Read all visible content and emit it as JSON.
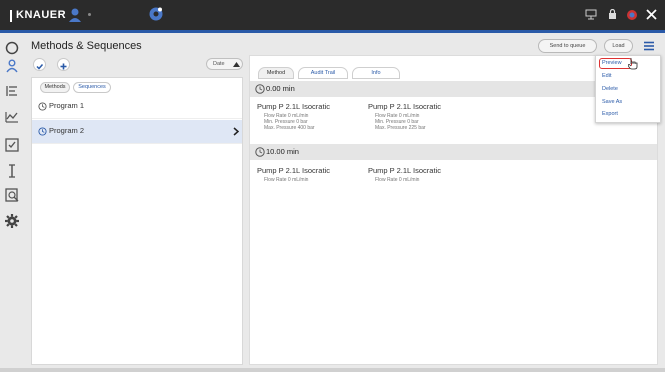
{
  "brand": {
    "name": "KNAUER"
  },
  "header": {
    "title": "Methods & Sequences",
    "send_to_queue": "Send to queue",
    "load": "Load"
  },
  "left": {
    "sort_label": "Date",
    "tabs": [
      "Methods",
      "Sequences"
    ],
    "programs": [
      "Program 1",
      "Program 2"
    ]
  },
  "right": {
    "tabs": [
      "Method",
      "Audit Trail",
      "Info"
    ],
    "blocks": [
      {
        "time": "0.00 min",
        "pumps": [
          {
            "title": "Pump P 2.1L Isocratic",
            "params": [
              "Flow Rate 0 mL/min",
              "Min. Pressure 0 bar",
              "Max. Pressure 400 bar"
            ]
          },
          {
            "title": "Pump P 2.1L Isocratic",
            "params": [
              "Flow Rate 0 mL/min",
              "Min. Pressure 0 bar",
              "Max. Pressure 225 bar"
            ]
          }
        ]
      },
      {
        "time": "10.00 min",
        "pumps": [
          {
            "title": "Pump P 2.1L Isocratic",
            "params": [
              "Flow Rate 0 mL/min"
            ]
          },
          {
            "title": "Pump P 2.1L Isocratic",
            "params": [
              "Flow Rate 0 mL/min"
            ]
          }
        ]
      }
    ]
  },
  "menu": {
    "items": [
      "Preview",
      "Edit",
      "Delete",
      "Save As",
      "Export"
    ]
  },
  "colors": {
    "accent": "#2a5aa8",
    "topbar": "#2b2b2b",
    "selected_row": "#dfe7f5",
    "highlight": "#d33333"
  },
  "icons": {
    "left_strip": [
      "connection-icon",
      "users-icon",
      "methods-icon",
      "chart-icon",
      "checklist-icon",
      "text-cursor-icon",
      "database-icon",
      "settings-icon"
    ],
    "top_right": [
      "network-icon",
      "lock-icon",
      "status-icon",
      "close-icon"
    ]
  }
}
